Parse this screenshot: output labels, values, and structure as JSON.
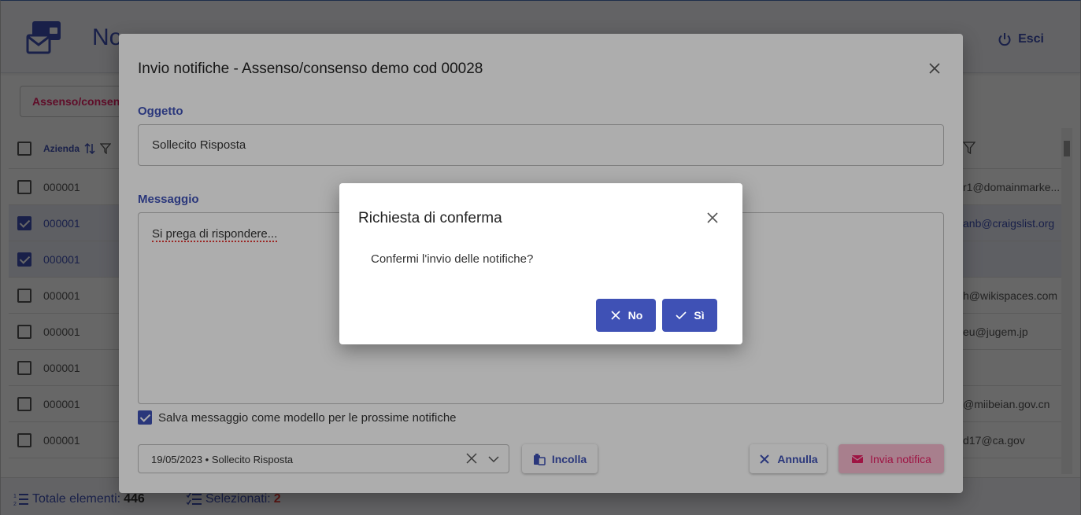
{
  "app": {
    "title": "Notifiche",
    "logout_label": "Esci",
    "filter_chip": "Assenso/consenso"
  },
  "table": {
    "header": {
      "azienda_label": "Azienda"
    },
    "rows": [
      {
        "azienda": "000001",
        "email": "r1@domainmarke...",
        "selected": false
      },
      {
        "azienda": "000001",
        "email": "anb@craigslist.org",
        "selected": true
      },
      {
        "azienda": "000001",
        "email": "",
        "selected": true
      },
      {
        "azienda": "000001",
        "email": "h@wikispaces.com",
        "selected": false
      },
      {
        "azienda": "000001",
        "email": "eu@jugem.jp",
        "selected": false
      },
      {
        "azienda": "000001",
        "email": "",
        "selected": false
      },
      {
        "azienda": "000001",
        "email": "@miibeian.gov.cn",
        "selected": false
      },
      {
        "azienda": "000001",
        "email": "d17@ca.gov",
        "selected": false
      }
    ]
  },
  "footer": {
    "total_label": "Totale elementi:",
    "total_value": "446",
    "selected_label": "Selezionati:",
    "selected_value": "2"
  },
  "dialog_notify": {
    "title": "Invio notifiche - Assenso/consenso demo cod 00028",
    "subject_label": "Oggetto",
    "subject_value": "Sollecito Risposta",
    "message_label": "Messaggio",
    "message_value": "Si prega di rispondere...",
    "save_template_label": "Salva messaggio come modello per le prossime notifiche",
    "template_selected": "19/05/2023 • Sollecito Risposta",
    "paste_label": "Incolla",
    "cancel_label": "Annulla",
    "send_label": "Invia notifica"
  },
  "dialog_confirm": {
    "title": "Richiesta di conferma",
    "message": "Confermi l'invio delle notifiche?",
    "no_label": "No",
    "yes_label": "Sì"
  },
  "colors": {
    "primary": "#3f51b5",
    "accent": "#e91e63",
    "selected_row": "#e8eaf6"
  }
}
